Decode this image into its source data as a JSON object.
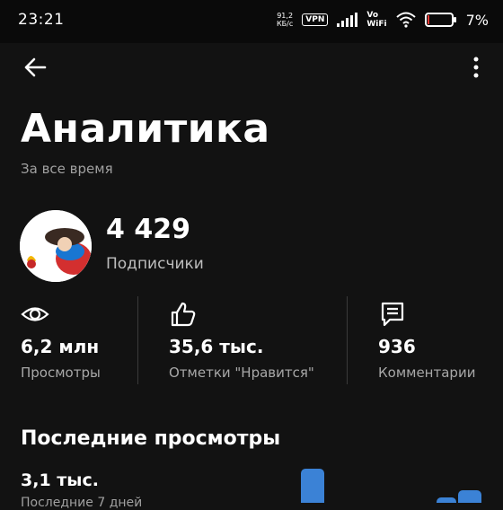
{
  "status_bar": {
    "time": "23:21",
    "net_speed_value": "91,2",
    "net_speed_unit": "КБ/с",
    "vpn": "VPN",
    "vowifi_top": "Vo",
    "vowifi_bottom": "WiFi",
    "battery": "7%",
    "battery_level": 0.07,
    "icons": [
      "signal-icon",
      "wifi-icon",
      "battery-icon"
    ]
  },
  "app_bar": {
    "icons": [
      "back-arrow-icon",
      "more-vert-icon"
    ]
  },
  "page": {
    "title": "Аналитика",
    "subtitle": "За все время"
  },
  "channel": {
    "subscribers_count": "4 429",
    "subscribers_label": "Подписчики"
  },
  "stats": [
    {
      "icon": "eye-icon",
      "value": "6,2 млн",
      "label": "Просмотры"
    },
    {
      "icon": "thumbs-up-icon",
      "value": "35,6 тыс.",
      "label": "Отметки \"Нравится\""
    },
    {
      "icon": "comment-icon",
      "value": "936",
      "label": "Комментарии"
    }
  ],
  "recent": {
    "title": "Последние просмотры",
    "value": "3,1 тыс.",
    "period": "Последние 7 дней"
  },
  "colors": {
    "background": "#121212",
    "accent_bar": "#3b82d6",
    "text_secondary": "#a8a8a8"
  }
}
